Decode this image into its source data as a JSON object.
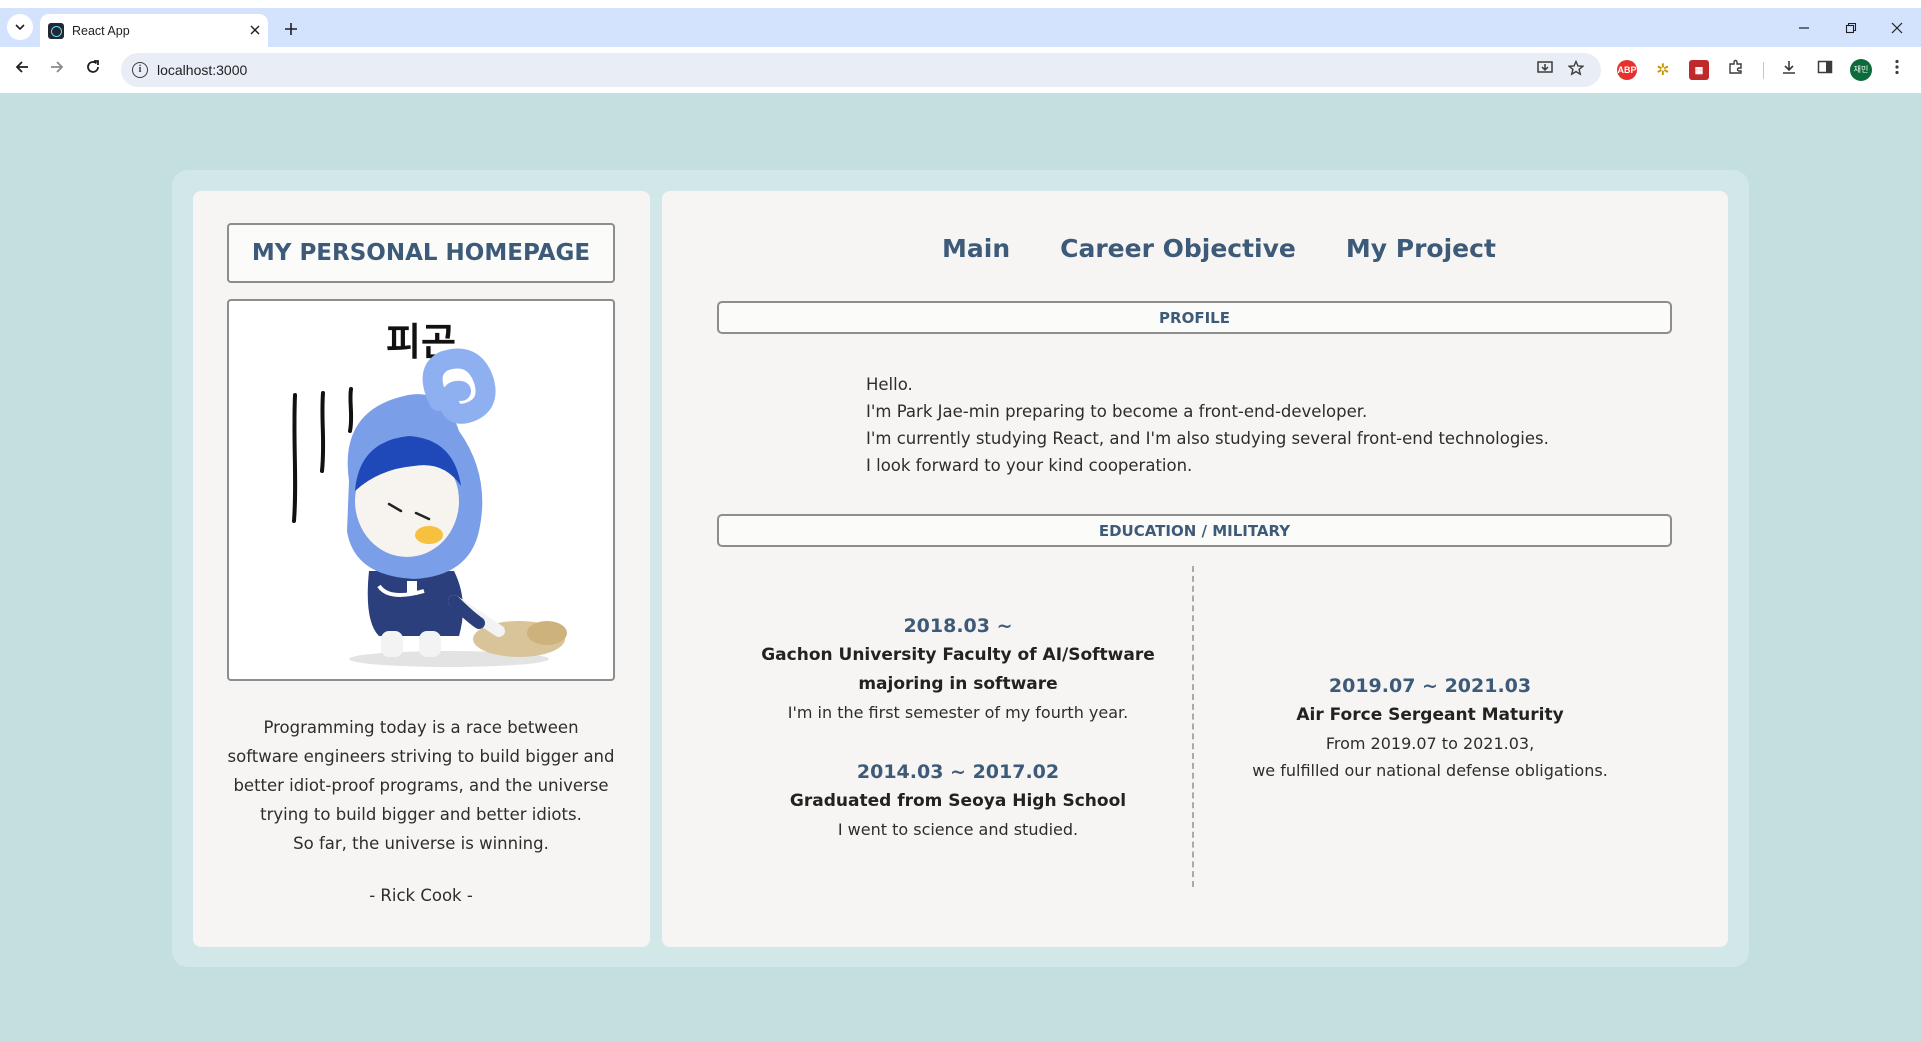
{
  "browser": {
    "tab_title": "React App",
    "url": "localhost:3000",
    "profile_initials": "재민"
  },
  "sidebar": {
    "site_title": "MY PERSONAL HOMEPAGE",
    "image_caption": "피곤",
    "quote_lines": [
      "Programming today is a race between",
      "software engineers striving to build bigger and",
      "better idiot-proof programs, and the universe",
      "trying to build bigger and better idiots.",
      "So far, the universe is winning."
    ],
    "quote_author": "- Rick Cook -"
  },
  "nav": {
    "items": [
      "Main",
      "Career Objective",
      "My Project"
    ]
  },
  "profile": {
    "heading": "PROFILE",
    "lines": [
      "Hello.",
      "I'm Park Jae-min preparing to become a front-end-developer.",
      "I'm currently studying React, and I'm also studying several front-end technologies.",
      "I look forward to your kind cooperation."
    ]
  },
  "education": {
    "heading": "EDUCATION / MILITARY",
    "entries": [
      {
        "date": "2018.03 ~",
        "name_lines": [
          "Gachon University Faculty of AI/Software",
          "majoring in software"
        ],
        "desc_lines": [
          "I'm in the first semester of my fourth year."
        ]
      },
      {
        "date": "2014.03 ~ 2017.02",
        "name_lines": [
          "Graduated from Seoya High School"
        ],
        "desc_lines": [
          "I went to science and studied."
        ]
      },
      {
        "date": "2019.07 ~ 2021.03",
        "name_lines": [
          "Air Force Sergeant Maturity"
        ],
        "desc_lines": [
          "From 2019.07 to 2021.03,",
          "we fulfilled our national defense obligations."
        ]
      }
    ]
  },
  "colors": {
    "page_background": "#c4dfe0",
    "accent_text": "#3d5a78",
    "panel_background": "#f6f5f3"
  }
}
